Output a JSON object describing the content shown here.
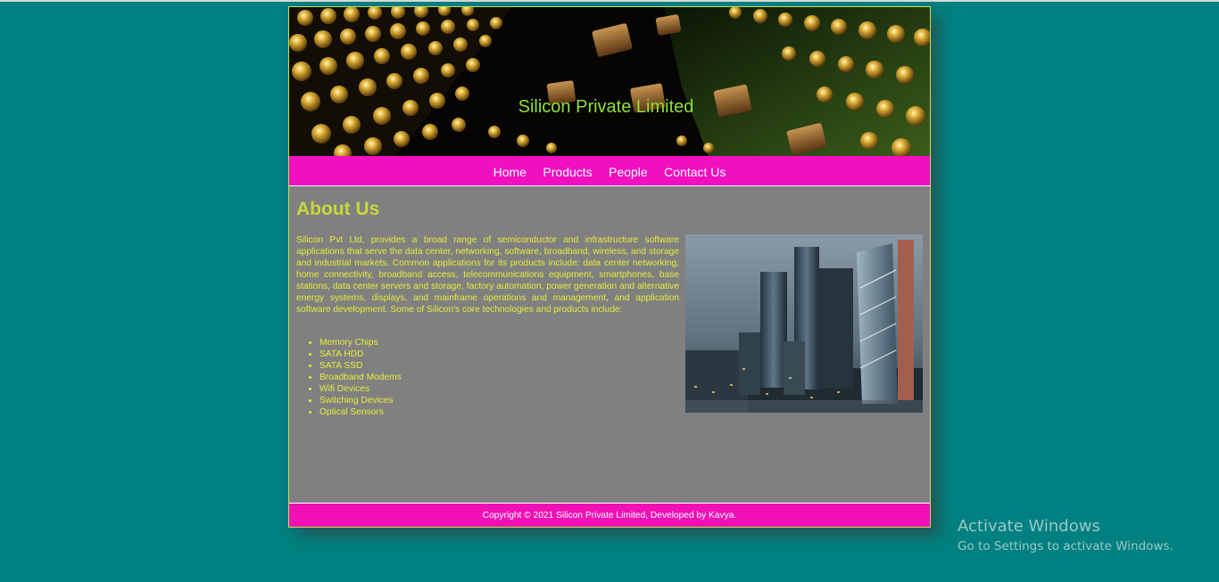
{
  "colors": {
    "page_background": "#008080",
    "nav_background": "#f010c0",
    "footer_background": "#f010b4",
    "content_background": "#808080",
    "heading_color": "#c7d93a",
    "text_color": "#e6ec3b",
    "banner_title_color": "#8ee03c"
  },
  "header": {
    "title": "Silicon Private Limited",
    "banner_image": "circuit-board-chips-image"
  },
  "nav": {
    "items": [
      {
        "label": "Home"
      },
      {
        "label": "Products"
      },
      {
        "label": "People"
      },
      {
        "label": "Contact Us"
      }
    ]
  },
  "main": {
    "heading": "About Us",
    "paragraph": "Silicon Pvt Ltd, provides a broad range of semiconductor and infrastructure software applications that serve the data center, networking, software, broadband, wireless, and storage and industrial markets. Common applications for its products include: data center networking, home connectivity, broadband access, telecommunications equipment, smartphones, base stations, data center servers and storage, factory automation, power generation and alternative energy systems, displays, and mainframe operations and management, and application software development. Some of Silicon's core technologies and products include:",
    "products": [
      "Memory Chips",
      "SATA HDD",
      "SATA SSD",
      "Broadband Modems",
      "Wifi Devices",
      "Switching Devices",
      "Optical Sensors"
    ],
    "image": "city-skyline-skyscrapers-image"
  },
  "footer": {
    "text": "Copyright © 2021 Silicon Private Limited, Developed by Kavya."
  },
  "os_overlay": {
    "line1": "Activate Windows",
    "line2": "Go to Settings to activate Windows."
  }
}
